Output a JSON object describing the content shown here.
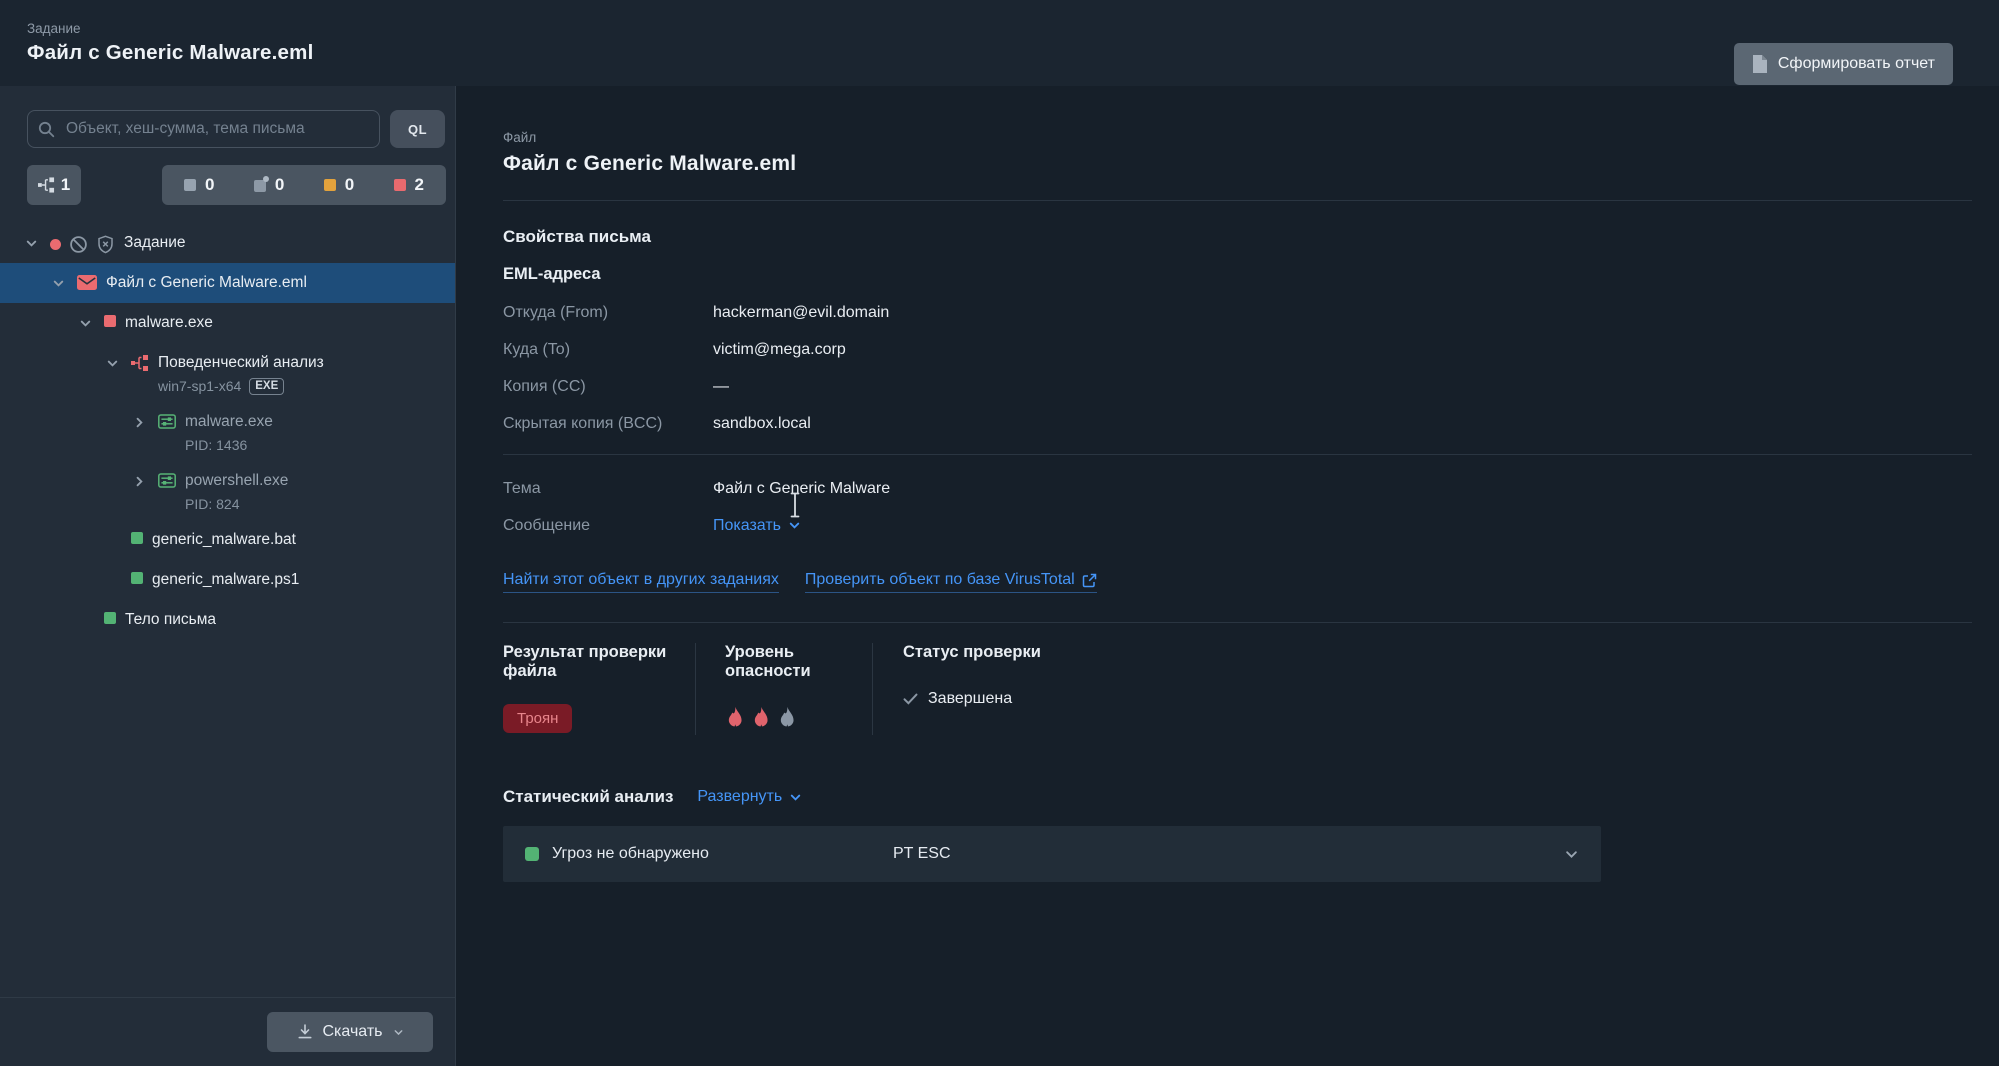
{
  "header": {
    "kicker": "Задание",
    "title": "Файл с Generic Malware.eml",
    "report_button": "Сформировать отчет"
  },
  "sidebar": {
    "search_placeholder": "Объект, хеш-сумма, тема письма",
    "ql_button": "QL",
    "behavioral_counter": "1",
    "counters": [
      {
        "icon": "gray-square",
        "color": "#97a3b0",
        "value": "0"
      },
      {
        "icon": "gray-square-dot",
        "color": "#8d99a6",
        "value": "0"
      },
      {
        "icon": "orange-square",
        "color": "#e3a23c",
        "value": "0"
      },
      {
        "icon": "red-square",
        "color": "#e96a6e",
        "value": "2"
      }
    ],
    "tree": [
      {
        "depth": 0,
        "expander": "down",
        "icons": [
          "red-dot",
          "ban-icon",
          "shield-x-icon"
        ],
        "label": "Задание",
        "selected": false
      },
      {
        "depth": 1,
        "expander": "down",
        "icons": [
          "envelope-icon"
        ],
        "label": "Файл с Generic Malware.eml",
        "selected": true
      },
      {
        "depth": 2,
        "expander": "down",
        "icons": [
          "red-square"
        ],
        "label": "malware.exe",
        "selected": false
      },
      {
        "depth": 3,
        "expander": "down",
        "icons": [
          "behavioral-icon"
        ],
        "label": "Поведенческий анализ",
        "sub": "win7-sp1-x64",
        "badge": "EXE",
        "selected": false
      },
      {
        "depth": 4,
        "expander": "right",
        "icons": [
          "process-icon"
        ],
        "label": "malware.exe",
        "sub": "PID: 1436",
        "dim": true,
        "selected": false
      },
      {
        "depth": 4,
        "expander": "right",
        "icons": [
          "process-icon"
        ],
        "label": "powershell.exe",
        "sub": "PID: 824",
        "dim": true,
        "selected": false
      },
      {
        "depth": 3,
        "expander": "none",
        "icons": [
          "green-square"
        ],
        "label": "generic_malware.bat",
        "selected": false
      },
      {
        "depth": 3,
        "expander": "none",
        "icons": [
          "green-square"
        ],
        "label": "generic_malware.ps1",
        "selected": false
      },
      {
        "depth": 2,
        "expander": "none",
        "icons": [
          "green-square"
        ],
        "label": "Тело письма",
        "selected": false
      }
    ],
    "download_button": "Скачать"
  },
  "main": {
    "kicker": "Файл",
    "title": "Файл с Generic Malware.eml",
    "properties_heading": "Свойства письма",
    "eml_heading": "EML-адреса",
    "fields": [
      {
        "label": "Откуда (From)",
        "value": "hackerman@evil.domain"
      },
      {
        "label": "Куда (To)",
        "value": "victim@mega.corp"
      },
      {
        "label": "Копия (CC)",
        "value": "—"
      },
      {
        "label": "Скрытая копия (BCC)",
        "value": "sandbox.local"
      }
    ],
    "subject_label": "Тема",
    "subject_value": "Файл с Generic Malware",
    "message_label": "Сообщение",
    "message_link": "Показать",
    "find_link": "Найти этот объект в других заданиях",
    "virustotal_link": "Проверить объект по базе VirusTotal",
    "verdict_heading": "Результат проверки файла",
    "verdict_badge": "Троян",
    "danger_heading": "Уровень опасности",
    "danger_flames": [
      "red",
      "red",
      "gray"
    ],
    "status_heading": "Статус проверки",
    "status_value": "Завершена",
    "static_heading": "Статический анализ",
    "static_expand_link": "Развернуть",
    "static_row": {
      "label": "Угроз не обнаружено",
      "source": "PT ESC"
    }
  },
  "colors": {
    "accent_blue": "#4595f7",
    "danger_red": "#ea6b70",
    "flame_red": "#e0636c",
    "flame_gray": "#8b97a5",
    "warning_orange": "#e3a23c",
    "success_green": "#53b374",
    "verdict_badge_bg": "#7a1b26",
    "verdict_badge_text": "#e8858c",
    "selected_row": "#1e4d7a"
  }
}
